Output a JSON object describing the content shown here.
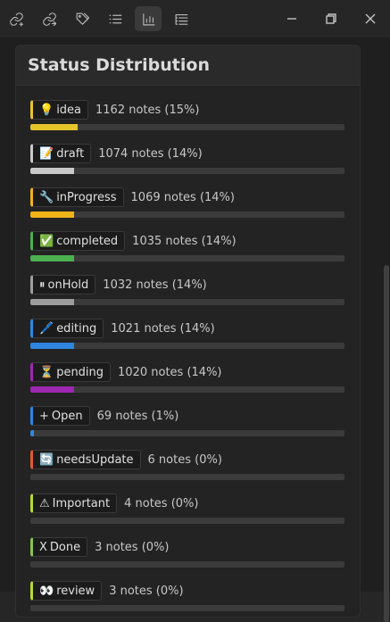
{
  "toolbar": {
    "buttons": [
      {
        "icon": "link-icon"
      },
      {
        "icon": "share-link-icon"
      },
      {
        "icon": "tags-icon"
      },
      {
        "icon": "list-icon"
      },
      {
        "icon": "bar-chart-icon",
        "active": true
      },
      {
        "icon": "outline-icon"
      }
    ],
    "window_controls": [
      "minimize-icon",
      "restore-icon",
      "close-icon"
    ]
  },
  "panel": {
    "title": "Status Distribution",
    "rows": [
      {
        "emoji": "💡",
        "label": "idea",
        "count": "1162 notes (15%)",
        "color": "#e6c52b",
        "percent": 15
      },
      {
        "emoji": "📝",
        "label": "draft",
        "count": "1074 notes (14%)",
        "color": "#c9c9c9",
        "percent": 14
      },
      {
        "emoji": "🔧",
        "label": "inProgress",
        "count": "1069 notes (14%)",
        "color": "#f0b318",
        "percent": 14
      },
      {
        "emoji": "✅",
        "label": "completed",
        "count": "1035 notes (14%)",
        "color": "#4caf50",
        "percent": 14
      },
      {
        "emoji": "⏸",
        "label": "onHold",
        "count": "1032 notes (14%)",
        "color": "#9e9e9e",
        "percent": 14
      },
      {
        "emoji": "🖊️",
        "label": "editing",
        "count": "1021 notes (14%)",
        "color": "#2f86e0",
        "percent": 14
      },
      {
        "emoji": "⏳",
        "label": "pending",
        "count": "1020 notes (14%)",
        "color": "#9c27b0",
        "percent": 14
      },
      {
        "emoji": "+",
        "label": "Open",
        "count": "69 notes (1%)",
        "color": "#2f86e0",
        "percent": 1
      },
      {
        "emoji": "🔄",
        "label": "needsUpdate",
        "count": "6 notes (0%)",
        "color": "#e05a2f",
        "percent": 0
      },
      {
        "emoji": "⚠",
        "label": "Important",
        "count": "4 notes (0%)",
        "color": "#b7d935",
        "percent": 0
      },
      {
        "emoji": "X",
        "label": "Done",
        "count": "3 notes (0%)",
        "color": "#8bc34a",
        "percent": 0
      },
      {
        "emoji": "👀",
        "label": "review",
        "count": "3 notes (0%)",
        "color": "#b7d935",
        "percent": 0
      }
    ]
  }
}
